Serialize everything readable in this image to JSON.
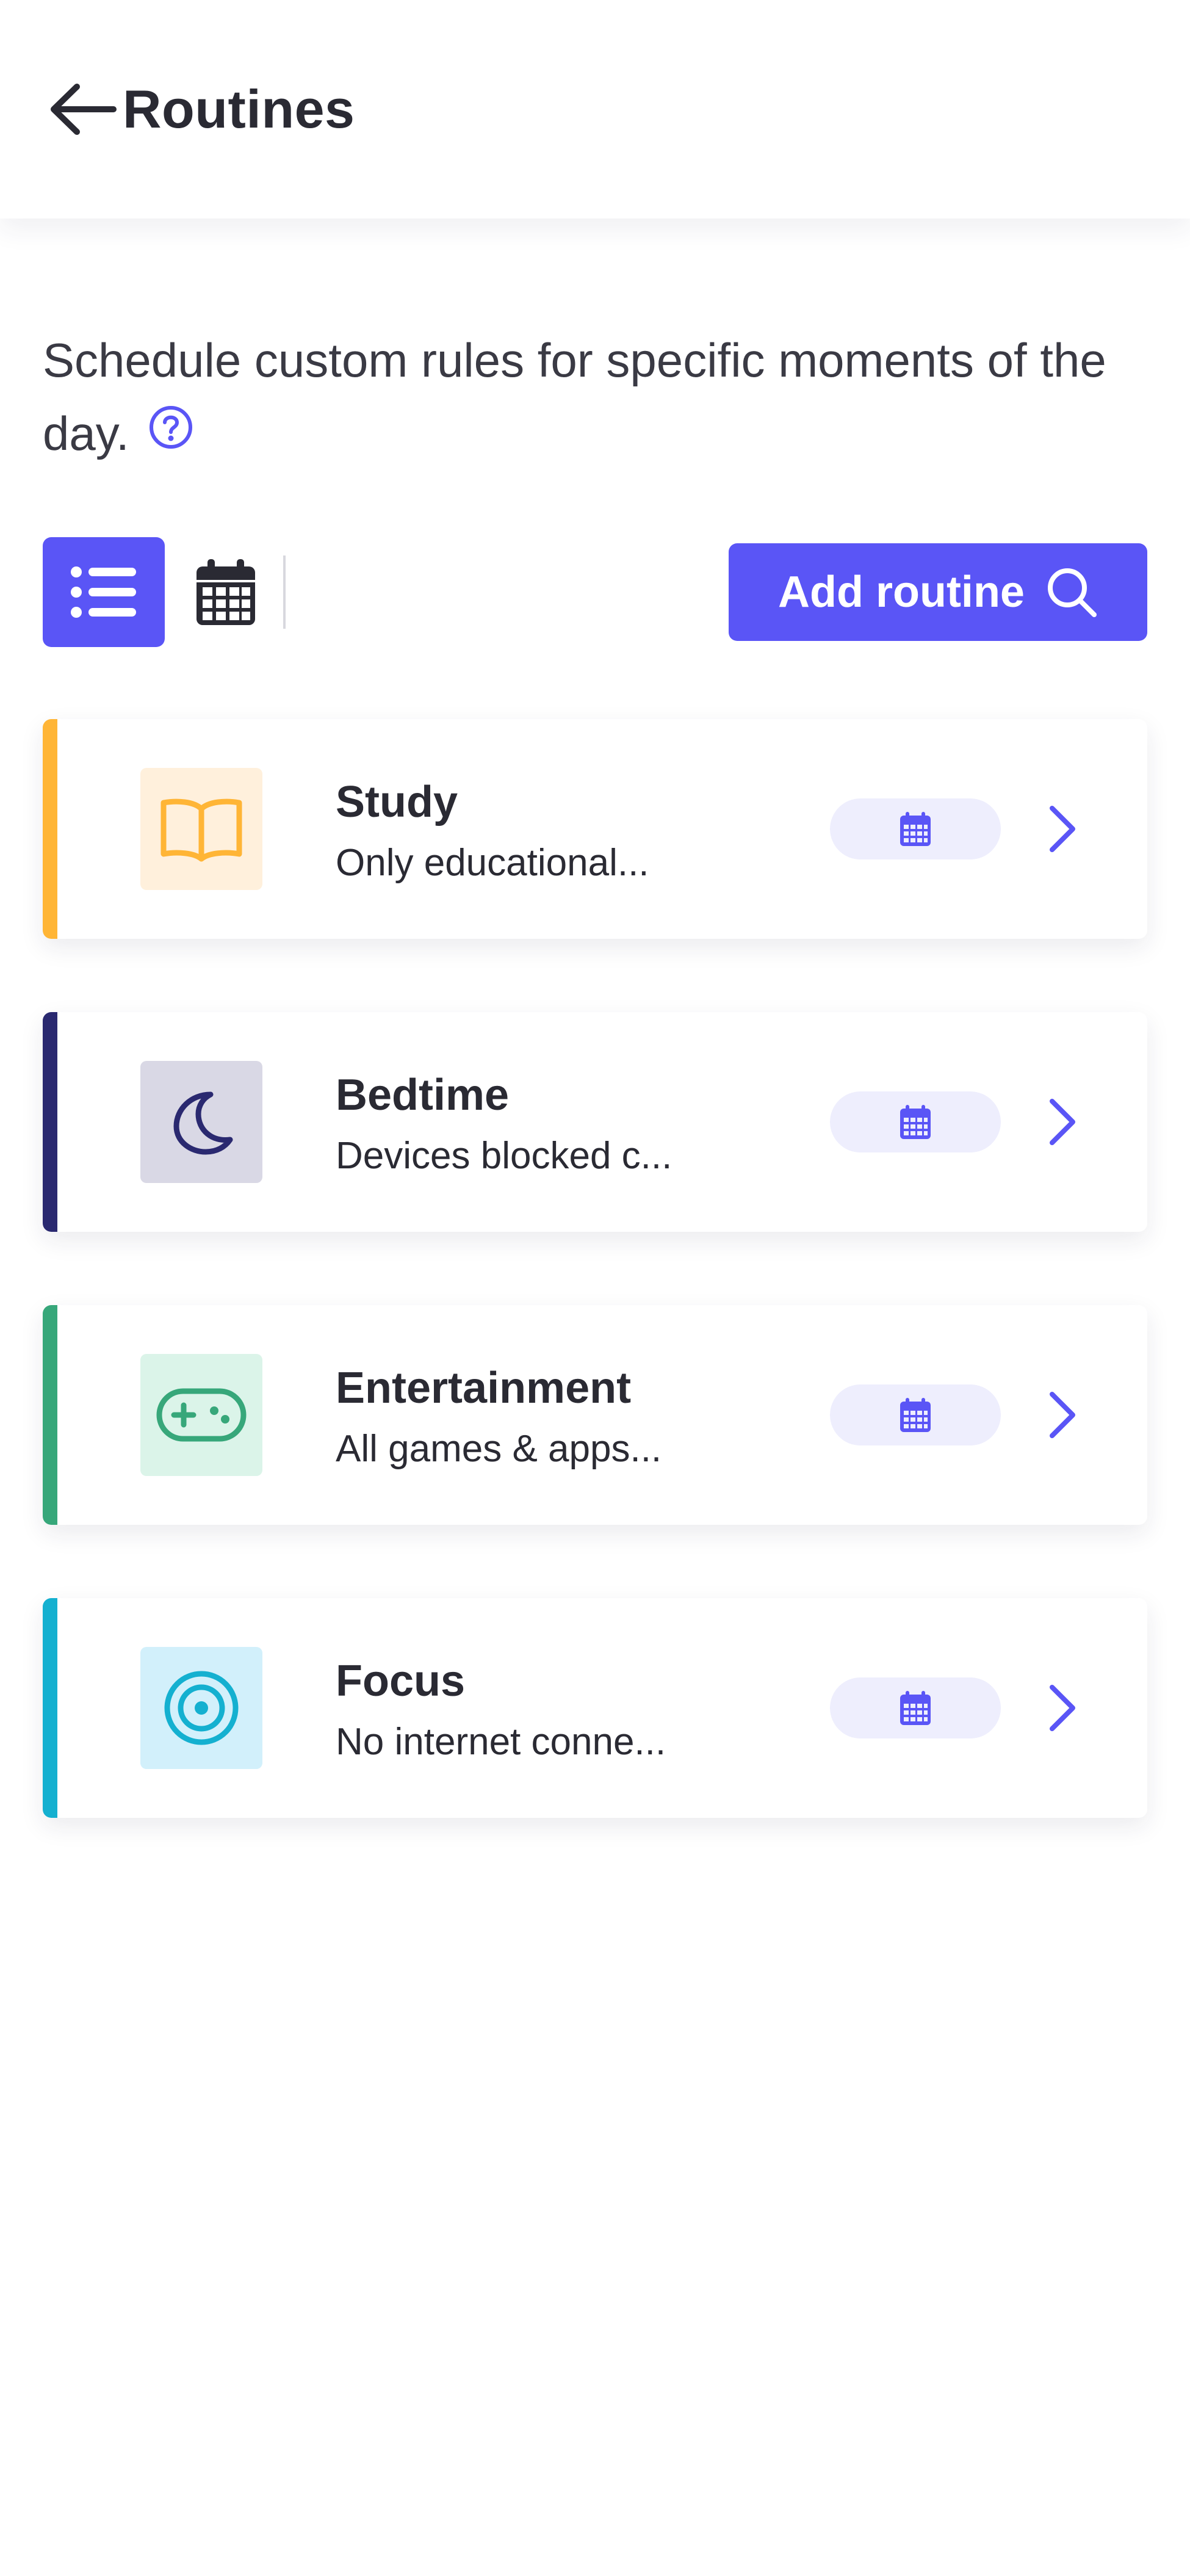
{
  "header": {
    "title": "Routines",
    "back_icon": "arrow-left-icon"
  },
  "description": {
    "text": "Schedule custom rules for specific moments of the day.",
    "help_icon": "question-circle-icon"
  },
  "toolbar": {
    "list_view_icon": "list-icon",
    "calendar_view_icon": "calendar-icon",
    "add_routine_label": "Add routine",
    "add_routine_icon": "search-icon"
  },
  "colors": {
    "primary": "#5a55f6",
    "pill_bg": "#eeeefd",
    "text": "#2a2a33"
  },
  "routines": [
    {
      "name": "Study",
      "description": "Only educational...",
      "icon": "book-icon",
      "accent": "#ffb536",
      "tile_bg": "#fff0dc",
      "icon_color": "#ffb536"
    },
    {
      "name": "Bedtime",
      "description": "Devices blocked c...",
      "icon": "moon-icon",
      "accent": "#2a2970",
      "tile_bg": "#d9d8e5",
      "icon_color": "#2a2970"
    },
    {
      "name": "Entertainment",
      "description": "All games & apps...",
      "icon": "gamepad-icon",
      "accent": "#37a77a",
      "tile_bg": "#dbf4e9",
      "icon_color": "#37a77a"
    },
    {
      "name": "Focus",
      "description": "No internet conne...",
      "icon": "target-icon",
      "accent": "#14b0d0",
      "tile_bg": "#d2f0fb",
      "icon_color": "#14b0d0"
    }
  ]
}
